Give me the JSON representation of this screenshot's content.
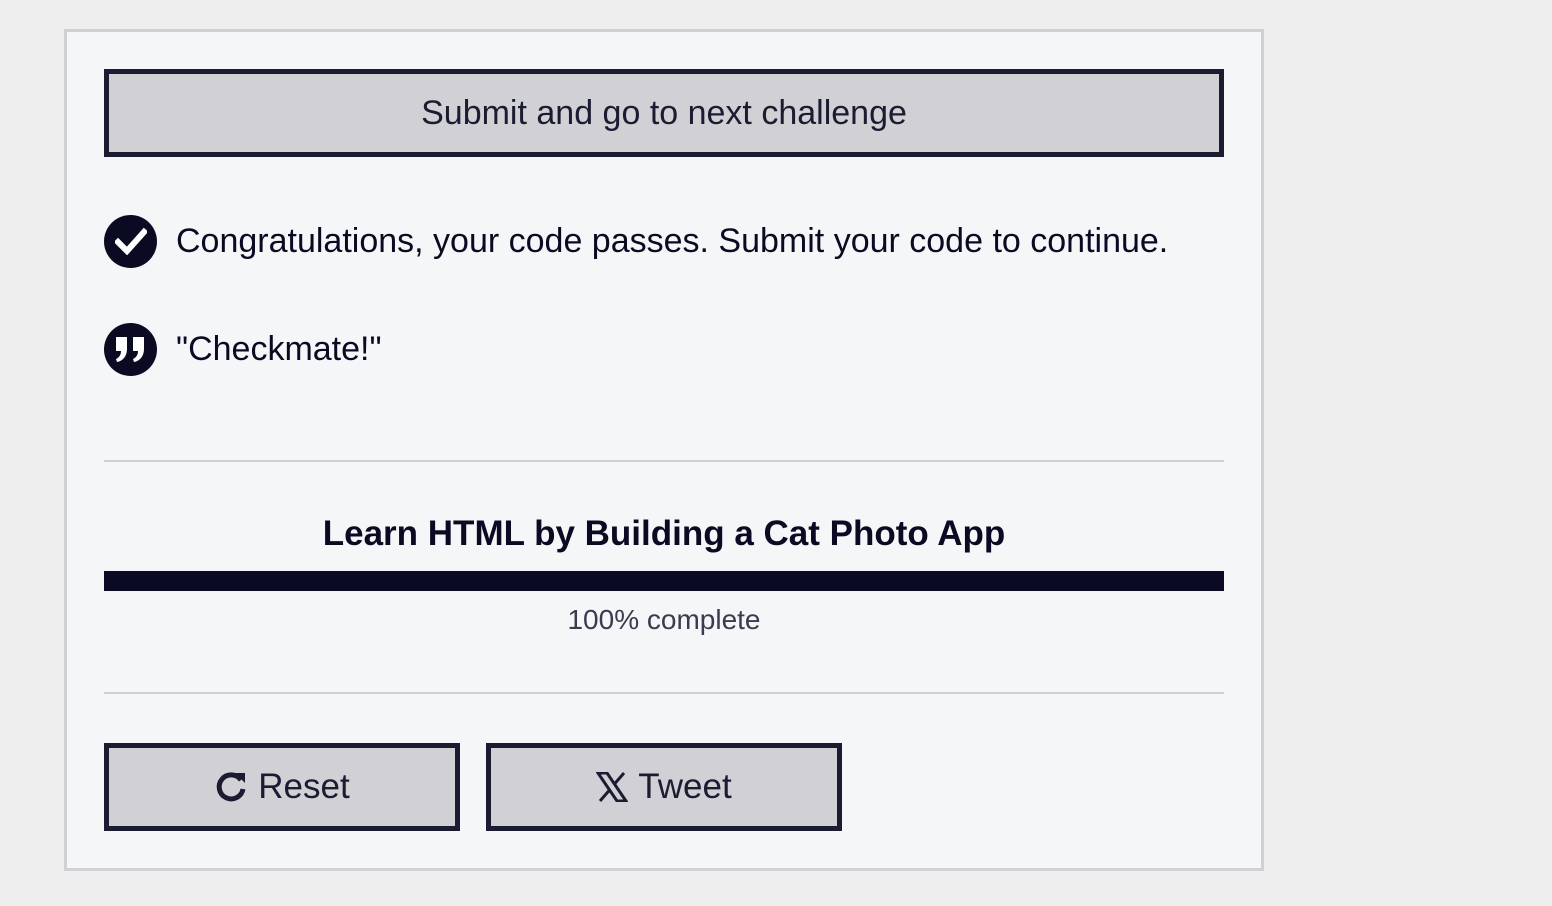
{
  "submit": {
    "label": "Submit and go to next challenge"
  },
  "messages": {
    "pass_text": "Congratulations, your code passes. Submit your code to continue.",
    "pass_icon": "check-circle-icon",
    "quote_text": "\"Checkmate!\"",
    "quote_icon": "quote-icon"
  },
  "course": {
    "title": "Learn HTML by Building a Cat Photo App",
    "progress_percent": 100,
    "progress_text": "100% complete"
  },
  "actions": {
    "reset_label": "Reset",
    "reset_icon": "refresh-icon",
    "tweet_label": "Tweet",
    "tweet_icon": "x-logo-icon"
  },
  "colors": {
    "background": "#eeeeee",
    "panel": "#f5f6f7",
    "button_bg": "#d0d0d5",
    "dark": "#0a0a23",
    "border": "#1b1b32"
  }
}
